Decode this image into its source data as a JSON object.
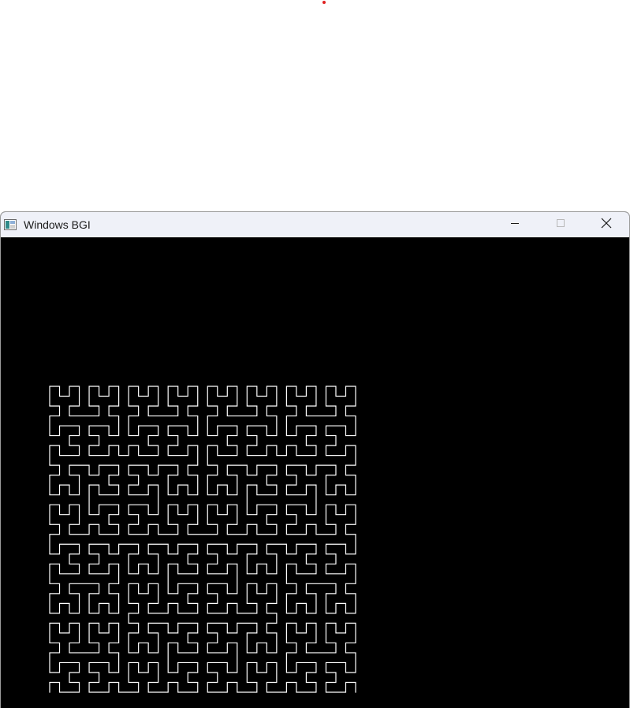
{
  "window": {
    "title": "Windows BGI",
    "icon": "bgi-app-icon",
    "controls": {
      "minimize_icon": "minimize-icon",
      "maximize_icon": "maximize-icon",
      "close_icon": "close-icon"
    }
  },
  "canvas": {
    "background": "#000000",
    "stroke": "#ffffff",
    "figure": "hilbert-curve",
    "order": 5
  },
  "colors": {
    "titlebar": "#eff1f8",
    "cursor_dot": "#e02020"
  }
}
